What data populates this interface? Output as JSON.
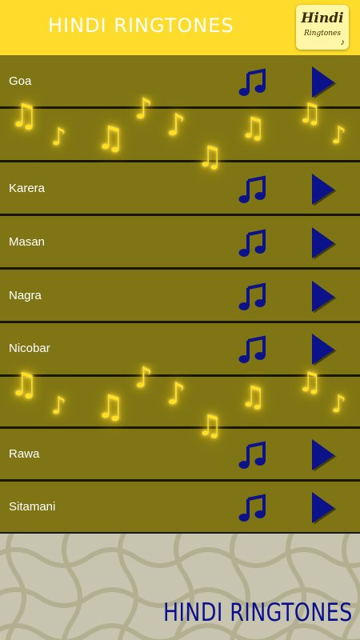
{
  "header": {
    "title": "HINDI RINGTONES"
  },
  "logo": {
    "line1": "Hindi",
    "line2": "Ringtones"
  },
  "ringtones": [
    {
      "label": "Goa"
    },
    {
      "label": "Karera"
    },
    {
      "label": "Masan"
    },
    {
      "label": "Nagra"
    },
    {
      "label": "Nicobar"
    },
    {
      "label": "Rawa"
    },
    {
      "label": "Sitamani"
    }
  ],
  "icons": {
    "row_note": "music-note-icon",
    "row_play": "play-icon",
    "decor": "music-note-icon"
  },
  "colors": {
    "header": "#fddc2b",
    "list_bg": "#7f7514",
    "icon_blue": "#0b128a",
    "note_glow": "#ffe020",
    "footer_bg": "#c7c5af"
  },
  "footer": {
    "title": "HINDI RINGTONES"
  }
}
